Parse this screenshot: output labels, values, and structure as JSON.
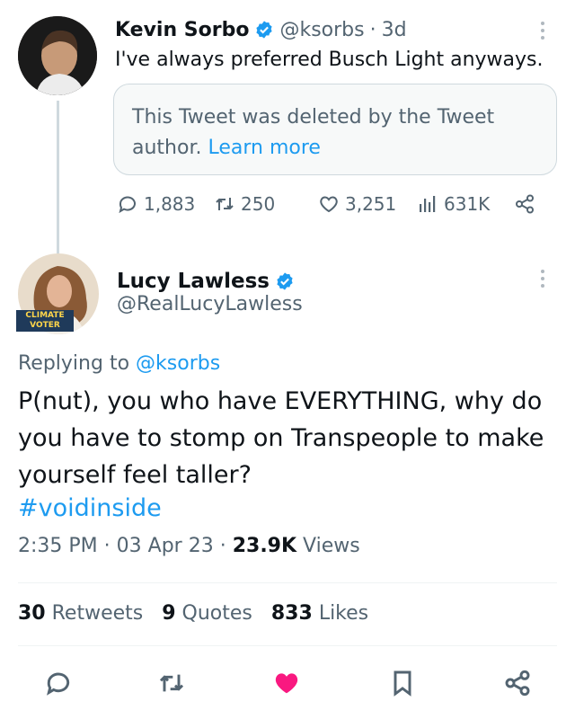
{
  "tweet1": {
    "name": "Kevin Sorbo",
    "handle": "@ksorbs",
    "sep": "·",
    "time": "3d",
    "text": "I've always preferred Busch Light anyways.",
    "quoted": {
      "text": "This Tweet was deleted by the Tweet author.",
      "link": "Learn more"
    },
    "stats": {
      "replies": "1,883",
      "retweets": "250",
      "likes": "3,251",
      "views": "631K"
    },
    "icons": [
      "reply-icon",
      "retweet-icon",
      "like-icon",
      "views-icon",
      "share-icon"
    ]
  },
  "tweet2": {
    "name": "Lucy Lawless",
    "handle": "@RealLucyLawless",
    "avatar_badge": "CLIMATE VOTER",
    "replying_prefix": "Replying to",
    "replying_handle": "@ksorbs",
    "text": "P(nut), you who have EVERYTHING, why do you have to stomp on Transpeople to make yourself feel taller?",
    "hashtag": "#voidinside",
    "meta": {
      "time": "2:35 PM",
      "sep1": "·",
      "date": "03 Apr 23",
      "sep2": "·",
      "views_count": "23.9K",
      "views_label": "Views"
    },
    "counts": {
      "retweets_num": "30",
      "retweets_label": "Retweets",
      "quotes_num": "9",
      "quotes_label": "Quotes",
      "likes_num": "833",
      "likes_label": "Likes"
    }
  },
  "colors": {
    "accent": "#1d9bf0",
    "like_active": "#f91880",
    "muted": "#536471",
    "border": "#cfd9de"
  }
}
